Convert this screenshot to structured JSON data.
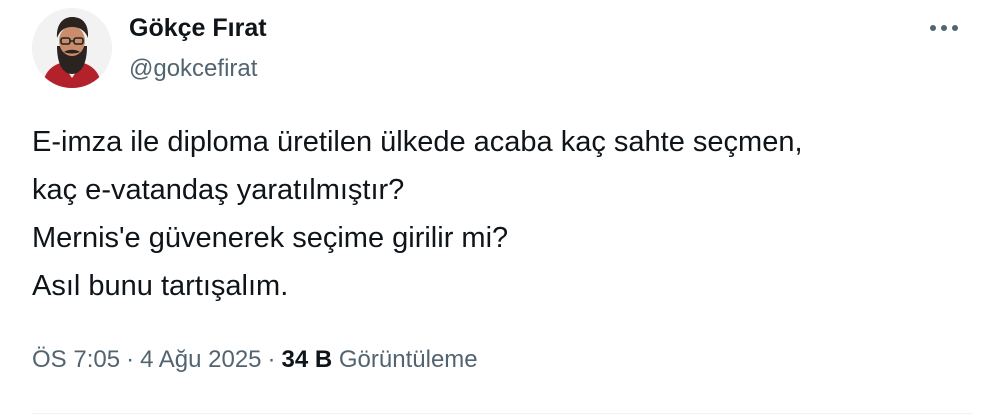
{
  "author": {
    "display_name": "Gökçe Fırat",
    "handle": "@gokcefirat"
  },
  "menu": {
    "icon": "more-horizontal-icon"
  },
  "tweet": {
    "lines": [
      "E-imza ile diploma üretilen ülkede acaba kaç sahte seçmen,",
      "kaç e-vatandaş yaratılmıştır?",
      "Mernis'e güvenerek seçime girilir mi?",
      "Asıl bunu tartışalım."
    ]
  },
  "meta": {
    "time": "ÖS 7:05",
    "separator": "·",
    "date": "4 Ağu 2025",
    "views_count": "34 B",
    "views_label": "Görüntüleme"
  },
  "colors": {
    "text_primary": "#0f1419",
    "text_secondary": "#536471",
    "divider": "#eff3f4"
  }
}
